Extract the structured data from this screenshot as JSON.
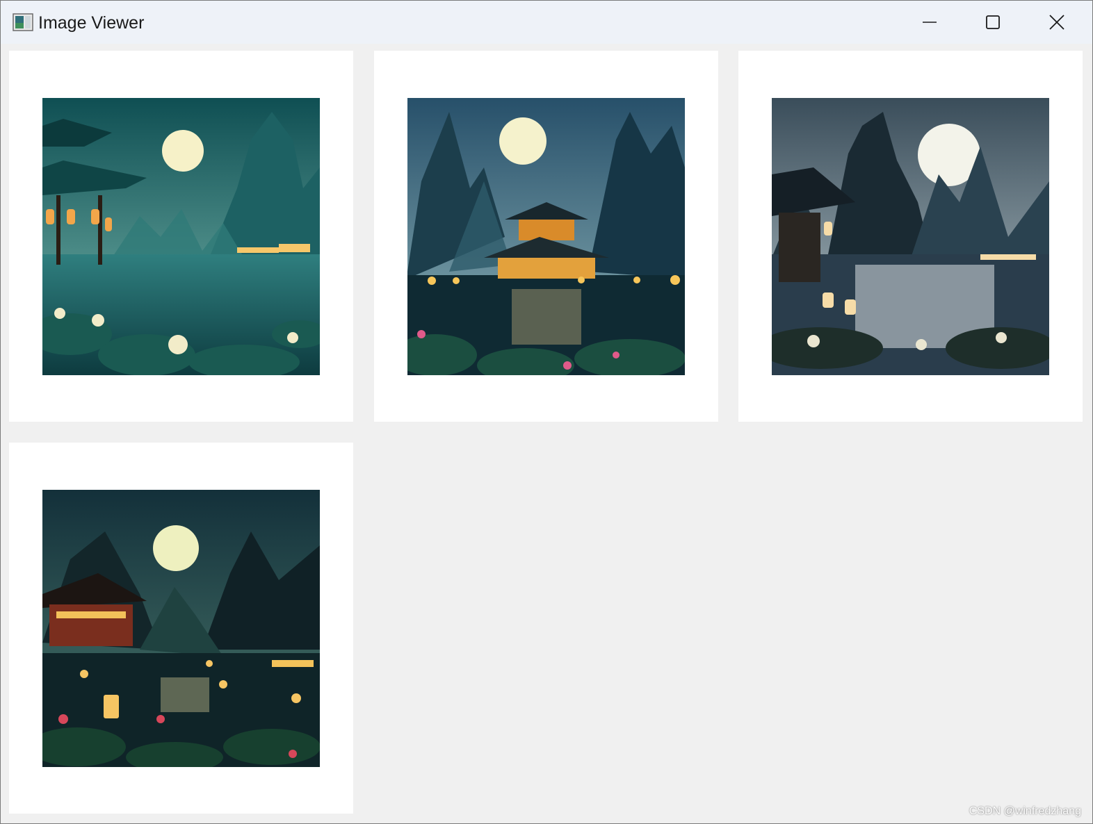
{
  "window": {
    "title": "Image Viewer",
    "app_icon": "image-viewer-app-icon",
    "controls": [
      {
        "name": "minimize",
        "icon": "minimize-icon"
      },
      {
        "name": "maximize",
        "icon": "maximize-icon"
      },
      {
        "name": "close",
        "icon": "close-icon"
      }
    ]
  },
  "gallery": {
    "background": "#f0f0f0",
    "tile_background": "#ffffff",
    "images": [
      {
        "scene": "teal-moonlit-pavilion-lotus-lake"
      },
      {
        "scene": "blue-pagoda-lantern-lake"
      },
      {
        "scene": "misty-karst-night-lake"
      },
      {
        "scene": "dark-pagoda-lantern-lotus-pond"
      }
    ]
  },
  "watermark": "CSDN @winfredzhang"
}
